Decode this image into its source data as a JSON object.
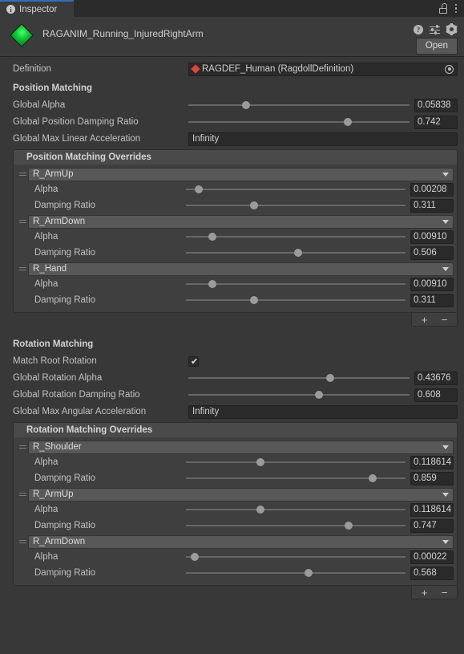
{
  "tab": {
    "label": "Inspector",
    "info_icon": "info-icon",
    "lock_icon": "unlock-icon",
    "menu_icon": "kebab-menu-icon"
  },
  "header": {
    "asset_icon": "green-diamond-asset-icon",
    "title": "RAGANIM_Running_InjuredRightArm",
    "help_icon": "help-icon",
    "preset_icon": "preset-sliders-icon",
    "settings_icon": "gear-icon",
    "open_button": "Open"
  },
  "definition": {
    "label": "Definition",
    "value": "RAGDEF_Human (RagdollDefinition)",
    "object_icon": "red-diamond-asset-icon",
    "picker_icon": "object-picker-target-icon"
  },
  "position_matching": {
    "title": "Position Matching",
    "global_alpha": {
      "label": "Global Alpha",
      "value": "0.05838",
      "slider_pct": 26
    },
    "global_damping": {
      "label": "Global Position Damping Ratio",
      "value": "0.742",
      "slider_pct": 72
    },
    "max_linear_accel": {
      "label": "Global Max Linear Acceleration",
      "value": "Infinity"
    },
    "overrides_title": "Position Matching Overrides",
    "overrides": [
      {
        "bone": "R_ArmUp",
        "alpha": {
          "label": "Alpha",
          "value": "0.00208",
          "slider_pct": 6
        },
        "damping": {
          "label": "Damping Ratio",
          "value": "0.311",
          "slider_pct": 31
        }
      },
      {
        "bone": "R_ArmDown",
        "alpha": {
          "label": "Alpha",
          "value": "0.00910",
          "slider_pct": 12
        },
        "damping": {
          "label": "Damping Ratio",
          "value": "0.506",
          "slider_pct": 51
        }
      },
      {
        "bone": "R_Hand",
        "alpha": {
          "label": "Alpha",
          "value": "0.00910",
          "slider_pct": 12
        },
        "damping": {
          "label": "Damping Ratio",
          "value": "0.311",
          "slider_pct": 31
        }
      }
    ],
    "add_button": "+",
    "remove_button": "−"
  },
  "rotation_matching": {
    "title": "Rotation Matching",
    "match_root": {
      "label": "Match Root Rotation",
      "checked": true,
      "check_glyph": "✔"
    },
    "global_alpha": {
      "label": "Global Rotation Alpha",
      "value": "0.43676",
      "slider_pct": 64
    },
    "global_damping": {
      "label": "Global Rotation Damping Ratio",
      "value": "0.608",
      "slider_pct": 59
    },
    "max_angular_accel": {
      "label": "Global Max Angular Acceleration",
      "value": "Infinity"
    },
    "overrides_title": "Rotation Matching Overrides",
    "overrides": [
      {
        "bone": "R_Shoulder",
        "alpha": {
          "label": "Alpha",
          "value": "0.118614",
          "slider_pct": 34
        },
        "damping": {
          "label": "Damping Ratio",
          "value": "0.859",
          "slider_pct": 85
        }
      },
      {
        "bone": "R_ArmUp",
        "alpha": {
          "label": "Alpha",
          "value": "0.118614",
          "slider_pct": 34
        },
        "damping": {
          "label": "Damping Ratio",
          "value": "0.747",
          "slider_pct": 74
        }
      },
      {
        "bone": "R_ArmDown",
        "alpha": {
          "label": "Alpha",
          "value": "0.00022",
          "slider_pct": 4
        },
        "damping": {
          "label": "Damping Ratio",
          "value": "0.568",
          "slider_pct": 56
        }
      }
    ],
    "add_button": "+",
    "remove_button": "−"
  }
}
